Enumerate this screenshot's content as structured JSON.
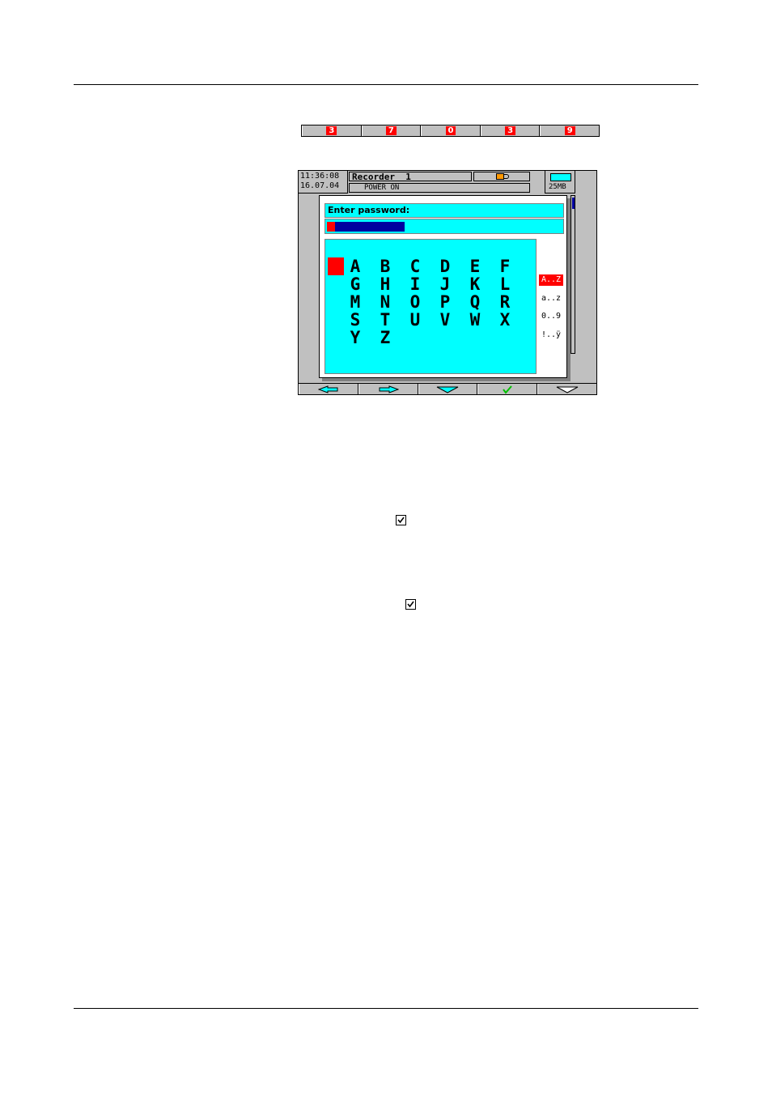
{
  "softkey_bar": [
    "3",
    "7",
    "0",
    "3",
    "9"
  ],
  "header": {
    "time": "11:36:08",
    "date": "16.07.04",
    "recorder_name": "Recorder  1",
    "status": "POWER ON",
    "memory": "25MB"
  },
  "dialog": {
    "prompt": "Enter password:",
    "characters": [
      "A",
      "B",
      "C",
      "D",
      "E",
      "F",
      "G",
      "H",
      "I",
      "J",
      "K",
      "L",
      "M",
      "N",
      "O",
      "P",
      "Q",
      "R",
      "S",
      "T",
      "U",
      "V",
      "W",
      "X",
      "Y",
      "Z"
    ],
    "charsets": [
      {
        "label": "A..Z",
        "active": true
      },
      {
        "label": "a..z",
        "active": false
      },
      {
        "label": "0..9",
        "active": false
      },
      {
        "label": "!..ÿ",
        "active": false
      }
    ]
  },
  "bottom_keys": [
    "left-arrow-icon",
    "right-arrow-icon",
    "down-arrow-icon",
    "check-icon",
    "down-arrow-outline-icon"
  ],
  "colors": {
    "screen_cyan": "#00ffff",
    "selection_red": "#ff0000",
    "password_bar": "#0000a0",
    "panel_gray": "#c0c0c0"
  }
}
